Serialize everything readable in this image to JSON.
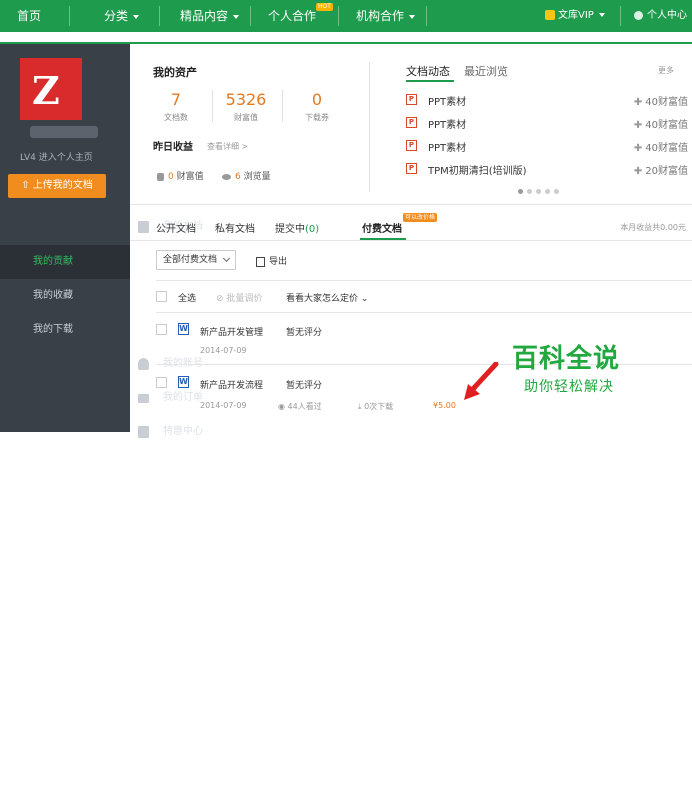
{
  "topnav": {
    "home": "首页",
    "category": "分类",
    "featured": "精品内容",
    "personal_coop": "个人合作",
    "hot_badge": "HOT",
    "org_coop": "机构合作",
    "vip": "文库VIP",
    "user_center": "个人中心"
  },
  "sidebar": {
    "level": "LV4",
    "enter_home": "进入个人主页",
    "upload": "上传我的文档",
    "my_docs": "我的文档",
    "items": [
      "我的贡献",
      "我的收藏",
      "我的下载"
    ],
    "my_account": "我的账号",
    "my_orders": "我的订单",
    "cut_off_item": "特惠中心"
  },
  "assets": {
    "title": "我的资产",
    "docs_count": "7",
    "docs_label": "文档数",
    "wealth": "5326",
    "wealth_label": "财富值",
    "coupons": "0",
    "coupons_label": "下载券",
    "yesterday": "昨日收益",
    "details": "查看详细 >",
    "wealth_inc": "0",
    "wealth_inc_label": "财富值",
    "views_inc": "6",
    "views_inc_label": "浏览量"
  },
  "activity": {
    "tab_active": "文档动态",
    "tab_other": "最近浏览",
    "more": "更多",
    "items": [
      {
        "name": "PPT素材",
        "coins": "40财富值"
      },
      {
        "name": "PPT素材",
        "coins": "40财富值"
      },
      {
        "name": "PPT素材",
        "coins": "40财富值"
      },
      {
        "name": "TPM初期清扫(培训版)",
        "coins": "20财富值"
      }
    ]
  },
  "filters": {
    "public": "公开文档",
    "private": "私有文档",
    "submitting": "提交中",
    "submitting_count": "(0)",
    "paid": "付费文档",
    "paid_tag": "可以改价格",
    "month_income": "本月收益共0.00元",
    "all_paid": "全部付费文档",
    "export": "导出",
    "select_all": "全选",
    "batch_price": "批量调价",
    "see_pricing": "看看大家怎么定价"
  },
  "docs": [
    {
      "name": "新产品开发管理",
      "rating": "暂无评分",
      "date": "2014-07-09"
    },
    {
      "name": "新产品开发流程",
      "rating": "暂无评分",
      "date": "2014-07-09",
      "views": "44人看过",
      "downloads": "0次下载",
      "price": "¥5.00"
    }
  ],
  "watermark": {
    "title": "百科全说",
    "subtitle": "助你轻松解决"
  },
  "colors": {
    "brand": "#1f9b4d",
    "accent": "#f18c1e",
    "sidebar": "#3a4048"
  }
}
